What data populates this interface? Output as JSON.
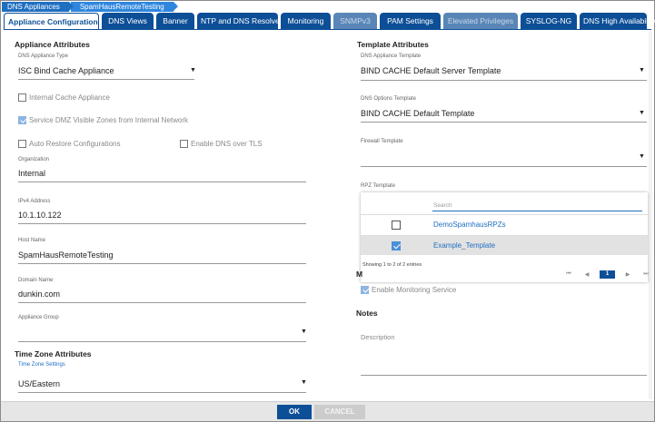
{
  "breadcrumb": [
    "DNS Appliances",
    "SpamHausRemoteTesting"
  ],
  "tabs": [
    {
      "label": "Appliance Configuration",
      "state": "active"
    },
    {
      "label": "DNS Views",
      "state": "normal"
    },
    {
      "label": "Banner",
      "state": "normal"
    },
    {
      "label": "NTP and DNS Resolver",
      "state": "normal"
    },
    {
      "label": "Monitoring",
      "state": "normal"
    },
    {
      "label": "SNMPv3",
      "state": "disabled"
    },
    {
      "label": "PAM Settings",
      "state": "normal"
    },
    {
      "label": "Elevated Privileges",
      "state": "disabled"
    },
    {
      "label": "SYSLOG-NG",
      "state": "normal"
    },
    {
      "label": "DNS High Availability",
      "state": "normal"
    }
  ],
  "appliance": {
    "heading": "Appliance Attributes",
    "type_label": "DNS Appliance Type",
    "type_value": "ISC Bind Cache Appliance",
    "internal_cache": "Internal Cache Appliance",
    "dmz": "Service DMZ Visible Zones from Internal Network",
    "auto_restore": "Auto Restore Configurations",
    "dns_tls": "Enable DNS over TLS",
    "org_label": "Organization",
    "org_value": "Internal",
    "ipv4_label": "IPv4 Address",
    "ipv4_value": "10.1.10.122",
    "host_label": "Host Name",
    "host_value": "SpamHausRemoteTesting",
    "domain_label": "Domain Name",
    "domain_value": "dunkin.com",
    "group_label": "Appliance Group",
    "group_value": ""
  },
  "timezone": {
    "heading": "Time Zone Attributes",
    "label": "Time Zone Settings",
    "value": "US/Eastern"
  },
  "template": {
    "heading": "Template Attributes",
    "appliance_label": "DNS Appliance Template",
    "appliance_value": "BIND CACHE Default Server Template",
    "options_label": "DNS Options Template",
    "options_value": "BIND CACHE Default Template",
    "firewall_label": "Firewall Template",
    "firewall_value": "",
    "rpz_label": "RPZ Template"
  },
  "rpz": {
    "search_placeholder": "Search",
    "rows": [
      {
        "name": "DemoSpamhausRPZs",
        "checked": false
      },
      {
        "name": "Example_Template",
        "checked": true
      }
    ],
    "footer": "Showing 1 to 2 of 2 entries",
    "pager": {
      "first": "⏮",
      "prev": "◀",
      "current": "1",
      "next": "▶",
      "last": "⏭"
    }
  },
  "monitoring": {
    "heading_fragment": "M",
    "enable": "Enable Monitoring Service"
  },
  "notes": {
    "heading": "Notes",
    "description": "Description"
  },
  "buttons": {
    "ok": "OK",
    "cancel": "CANCEL"
  }
}
